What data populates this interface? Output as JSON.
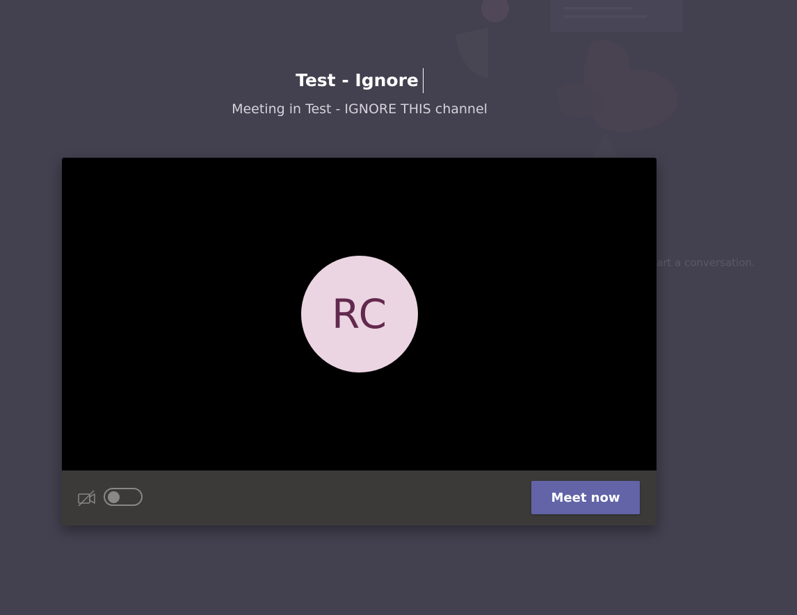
{
  "meeting": {
    "title": "Test - Ignore",
    "subtitle": "Meeting in Test - IGNORE THIS channel"
  },
  "preview": {
    "avatar_initials": "RC"
  },
  "controls": {
    "camera_icon": "camera-off-icon",
    "camera_toggle_state": "off",
    "meet_now_label": "Meet now"
  },
  "background": {
    "hint_text": "art a conversation."
  },
  "colors": {
    "accent": "#6264a7",
    "page_background": "#43404f",
    "avatar_background": "#ecd5e2",
    "avatar_text": "#62294e",
    "controls_bar": "#3b3a39"
  }
}
